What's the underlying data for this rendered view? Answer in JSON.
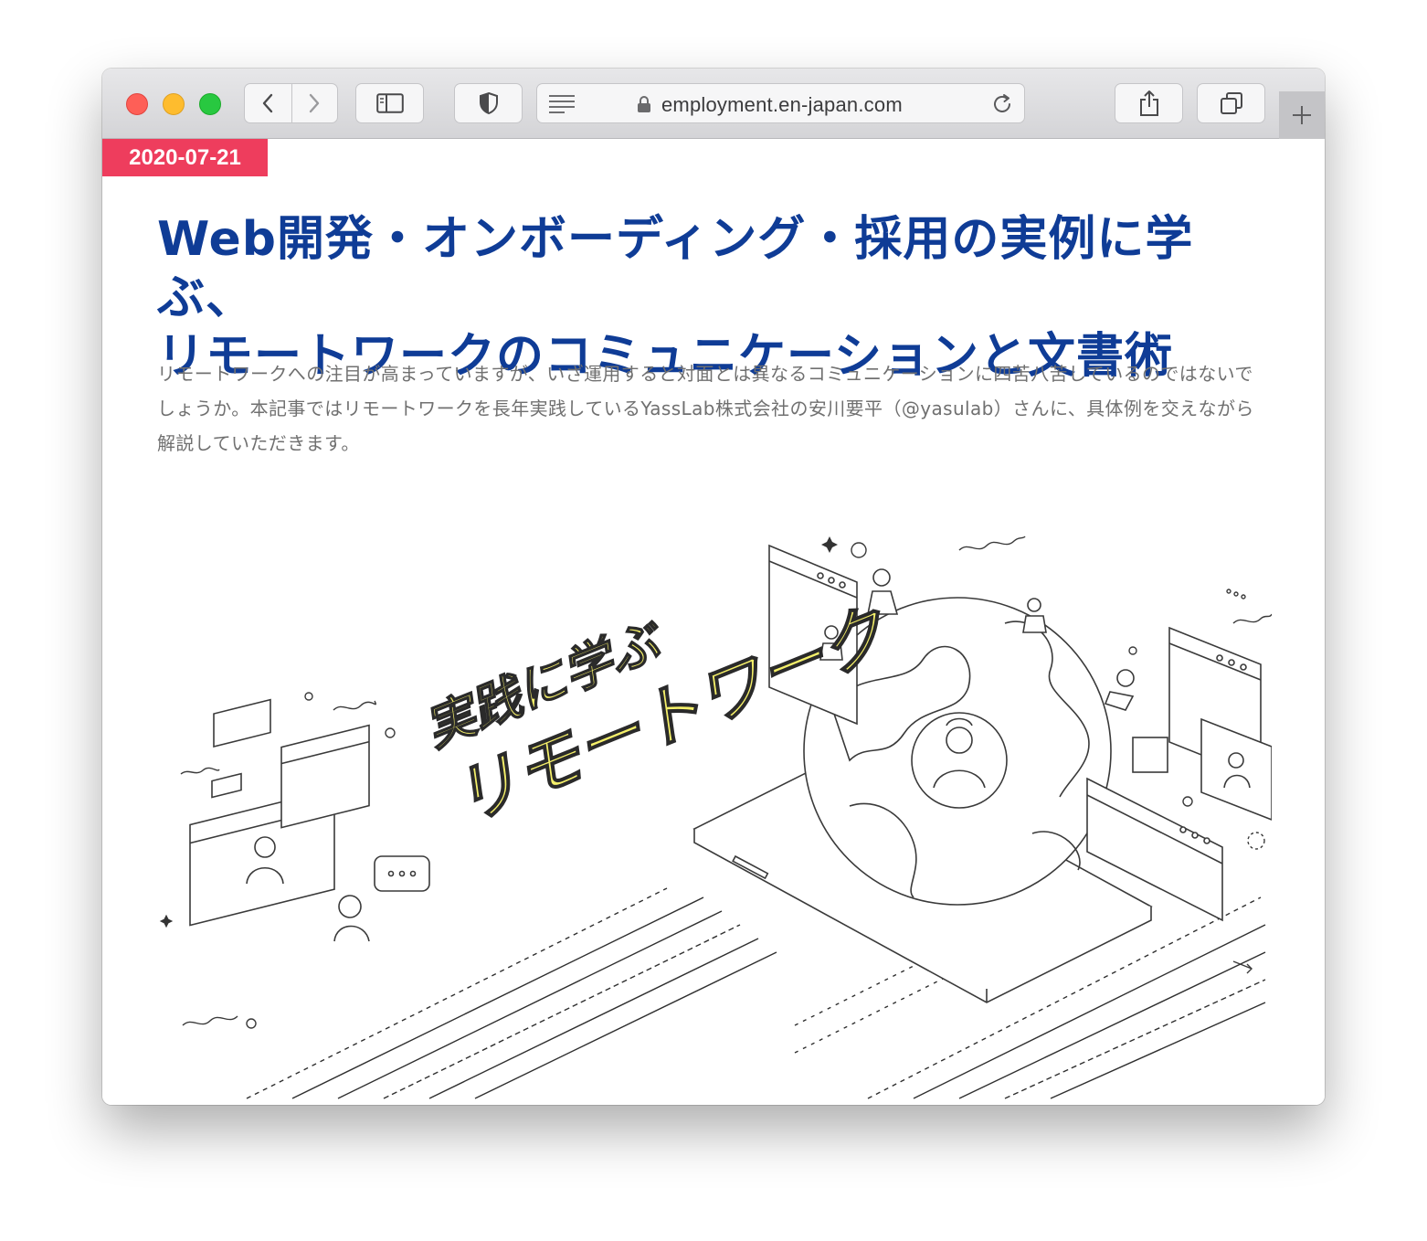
{
  "browser": {
    "url": "employment.en-japan.com",
    "icons": {
      "back": "chevron-left-icon",
      "forward": "chevron-right-icon",
      "sidebar": "sidebar-icon",
      "privacy": "shield-icon",
      "reader": "reader-mode-icon",
      "lock": "lock-icon",
      "reload": "reload-icon",
      "share": "share-icon",
      "tabs": "tab-overview-icon",
      "new_tab": "plus-icon"
    }
  },
  "article": {
    "date": "2020-07-21",
    "title_line1": "Web開発・オンボーディング・採用の実例に学ぶ、",
    "title_line2": "リモートワークのコミュニケーションと文書術",
    "lede": "リモートワークへの注目が高まっていますが、いざ運用すると対面とは異なるコミュニケーションに四苦八苦しているのではないでしょうか。本記事ではリモートワークを長年実践しているYassLab株式会社の安川要平（@yasulab）さんに、具体例を交えながら解説していただきます。",
    "hero": {
      "line1": "実践に学ぶ",
      "line2": "リモートワーク",
      "accent_color": "#f5f06a"
    }
  },
  "colors": {
    "title": "#0f3c96",
    "badge": "#ee3d5d",
    "lede": "#707070"
  }
}
